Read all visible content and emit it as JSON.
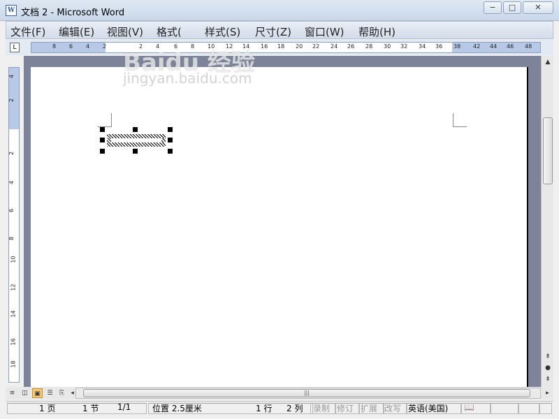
{
  "window": {
    "title": "文档 2 - Microsoft Word",
    "icon": "word-doc-icon",
    "icon_letter": "W",
    "controls": {
      "minimize": "−",
      "maximize": "□",
      "close": "✕"
    }
  },
  "menubar": {
    "items": [
      "文件(F)",
      "编辑(E)",
      "视图(V)",
      "格式(",
      "样式(S)",
      "尺寸(Z)",
      "窗口(W)",
      "帮助(H)"
    ]
  },
  "ruler": {
    "corner": "L",
    "horizontal_ticks": [
      "8",
      "6",
      "4",
      "2",
      "2",
      "4",
      "6",
      "8",
      "10",
      "12",
      "14",
      "16",
      "18",
      "20",
      "22",
      "24",
      "26",
      "28",
      "30",
      "32",
      "34",
      "36",
      "38",
      "42",
      "44",
      "46",
      "48"
    ],
    "vertical_ticks": [
      "4",
      "2",
      "2",
      "4",
      "6",
      "8",
      "10",
      "12",
      "14",
      "16",
      "18"
    ]
  },
  "statusbar": {
    "page": "1 页",
    "section": "1 节",
    "page_of": "1/1",
    "position": "位置 2.5厘米",
    "line": "1 行",
    "column": "2 列",
    "rec": "录制",
    "trk": "修订",
    "ext": "扩展",
    "ovr": "改写",
    "language": "英语(美国)"
  },
  "watermark": {
    "line1": "Baidu 经验",
    "line2": "jingyan.baidu.com"
  },
  "colors": {
    "doc_background": "#7d8499",
    "ruler_margin": "#b7c9e6",
    "active_view": "#f5c978"
  }
}
